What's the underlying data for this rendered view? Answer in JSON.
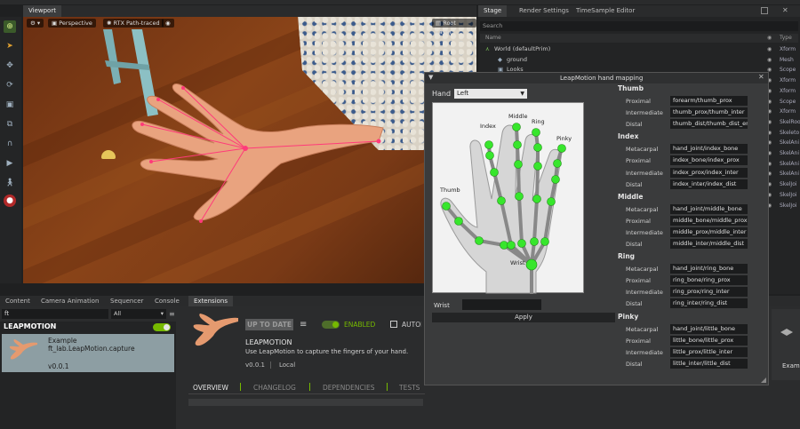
{
  "viewport": {
    "tab": "Viewport",
    "camera": "Perspective",
    "render_mode": "RTX Path-traced",
    "layer": "Root Layer"
  },
  "stage_panel": {
    "tabs": [
      "Stage",
      "Render Settings",
      "TimeSample Editor"
    ],
    "search_placeholder": "Search",
    "col_name": "Name",
    "col_type": "Type",
    "rows": [
      {
        "name": "World (defaultPrim)",
        "type": "Xform"
      },
      {
        "name": "ground",
        "type": "Mesh"
      },
      {
        "name": "Looks",
        "type": "Scope"
      },
      {
        "name": "",
        "type": "Xform"
      },
      {
        "name": "",
        "type": "Xform"
      },
      {
        "name": "",
        "type": "Scope"
      },
      {
        "name": "",
        "type": "Xform"
      },
      {
        "name": "",
        "type": "SkelRoo"
      },
      {
        "name": "",
        "type": "Skeleto"
      },
      {
        "name": "",
        "type": "SkelAni"
      },
      {
        "name": "",
        "type": "SkelAni"
      },
      {
        "name": "",
        "type": "SkelAni"
      },
      {
        "name": "",
        "type": "SkelAni"
      },
      {
        "name": "",
        "type": "SkelJoi"
      },
      {
        "name": "",
        "type": "SkelJoi"
      },
      {
        "name": "",
        "type": "SkelJoi"
      }
    ]
  },
  "bottom_tabs": [
    "Content",
    "Camera Animation",
    "Sequencer",
    "Console",
    "Extensions"
  ],
  "extensions": {
    "search_value": "ft",
    "filter_value": "All",
    "section": "LEAPMOTION",
    "item": {
      "title": "Example",
      "id": "ft_lab.LeapMotion.capture",
      "version": "v0.0.1"
    },
    "detail": {
      "up_to_date": "UP TO DATE",
      "enabled_label": "ENABLED",
      "autoload_label": "AUTOLOAD",
      "name": "LEAPMOTION",
      "description": "Use LeapMotion to capture the fingers of your hand.",
      "version": "v0.0.1",
      "location": "Local",
      "tabs": [
        "OVERVIEW",
        "CHANGELOG",
        "DEPENDENCIES",
        "TESTS"
      ]
    },
    "right_item": "Examp"
  },
  "dialog": {
    "title": "LeapMotion hand mapping",
    "hand_label": "Hand",
    "hand_value": "Left",
    "finger_labels": [
      "Thumb",
      "Index",
      "Middle",
      "Ring",
      "Pinky",
      "Wrist"
    ],
    "wrist_label": "Wrist",
    "wrist_value": "",
    "apply_label": "Apply",
    "groups": [
      {
        "name": "Thumb",
        "rows": [
          {
            "label": "Proximal",
            "value": "forearm/thumb_prox"
          },
          {
            "label": "Intermediate",
            "value": "thumb_prox/thumb_inter"
          },
          {
            "label": "Distal",
            "value": "thumb_dist/thumb_dist_end"
          }
        ]
      },
      {
        "name": "Index",
        "rows": [
          {
            "label": "Metacarpal",
            "value": "hand_joint/index_bone"
          },
          {
            "label": "Proximal",
            "value": "index_bone/index_prox"
          },
          {
            "label": "Intermediate",
            "value": "index_prox/index_inter"
          },
          {
            "label": "Distal",
            "value": "index_inter/index_dist"
          }
        ]
      },
      {
        "name": "Middle",
        "rows": [
          {
            "label": "Metacarpal",
            "value": "hand_joint/middle_bone"
          },
          {
            "label": "Proximal",
            "value": "middle_bone/middle_prox"
          },
          {
            "label": "Intermediate",
            "value": "middle_prox/middle_inter"
          },
          {
            "label": "Distal",
            "value": "middle_inter/middle_dist"
          }
        ]
      },
      {
        "name": "Ring",
        "rows": [
          {
            "label": "Metacarpal",
            "value": "hand_joint/ring_bone"
          },
          {
            "label": "Proximal",
            "value": "ring_bone/ring_prox"
          },
          {
            "label": "Intermediate",
            "value": "ring_prox/ring_inter"
          },
          {
            "label": "Distal",
            "value": "ring_inter/ring_dist"
          }
        ]
      },
      {
        "name": "Pinky",
        "rows": [
          {
            "label": "Metacarpal",
            "value": "hand_joint/little_bone"
          },
          {
            "label": "Proximal",
            "value": "little_bone/little_prox"
          },
          {
            "label": "Intermediate",
            "value": "little_prox/little_inter"
          },
          {
            "label": "Distal",
            "value": "little_inter/little_dist"
          }
        ]
      }
    ]
  },
  "colors": {
    "accent_green": "#76b900",
    "joint_green": "#37e62c",
    "hand_fill": "#d8d8d8",
    "dialog_bg": "#3a3b3c"
  }
}
